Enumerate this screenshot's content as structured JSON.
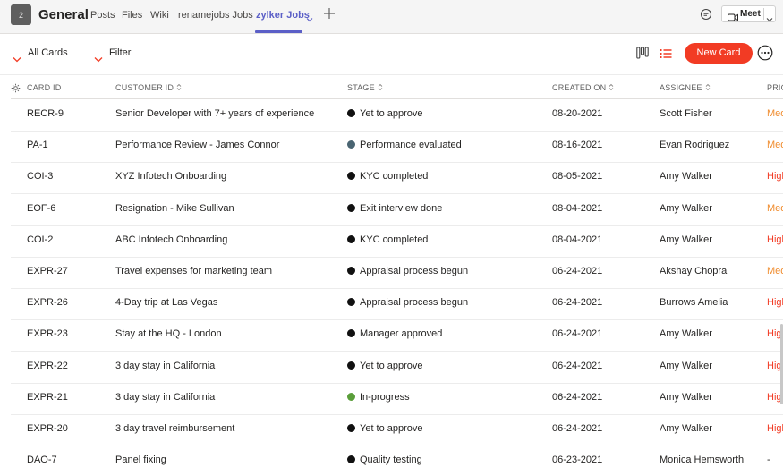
{
  "header": {
    "team_avatar": "2",
    "team_name": "General",
    "tabs": [
      {
        "label": "Posts"
      },
      {
        "label": "Files"
      },
      {
        "label": "Wiki"
      },
      {
        "label": "renamejobs Jobs"
      },
      {
        "label": "zylker Jobs"
      }
    ],
    "meet_label": "Meet"
  },
  "toolbar": {
    "view_label": "All Cards",
    "filter_label": "Filter",
    "new_card_label": "New Card"
  },
  "table": {
    "columns": {
      "card_id": "CARD ID",
      "customer_id": "CUSTOMER ID",
      "stage": "STAGE",
      "created_on": "CREATED ON",
      "assignee": "ASSIGNEE",
      "priority": "PRIO"
    },
    "rows": [
      {
        "card_id": "RECR-9",
        "customer": "Senior Developer with 7+ years of experience",
        "stage": "Yet to approve",
        "stage_color": "#111111",
        "created": "08-20-2021",
        "assignee": "Scott Fisher",
        "priority": "Med",
        "priority_level": "medium"
      },
      {
        "card_id": "PA-1",
        "customer": "Performance Review - James Connor",
        "stage": "Performance evaluated",
        "stage_color": "#4a6572",
        "created": "08-16-2021",
        "assignee": "Evan Rodriguez",
        "priority": "Med",
        "priority_level": "medium"
      },
      {
        "card_id": "COI-3",
        "customer": "XYZ Infotech Onboarding",
        "stage": "KYC completed",
        "stage_color": "#111111",
        "created": "08-05-2021",
        "assignee": "Amy Walker",
        "priority": "High",
        "priority_level": "high"
      },
      {
        "card_id": "EOF-6",
        "customer": "Resignation - Mike Sullivan",
        "stage": "Exit interview done",
        "stage_color": "#111111",
        "created": "08-04-2021",
        "assignee": "Amy Walker",
        "priority": "Med",
        "priority_level": "medium"
      },
      {
        "card_id": "COI-2",
        "customer": "ABC Infotech Onboarding",
        "stage": "KYC completed",
        "stage_color": "#111111",
        "created": "08-04-2021",
        "assignee": "Amy Walker",
        "priority": "High",
        "priority_level": "high"
      },
      {
        "card_id": "EXPR-27",
        "customer": "Travel expenses for marketing team",
        "stage": "Appraisal process begun",
        "stage_color": "#111111",
        "created": "06-24-2021",
        "assignee": "Akshay Chopra",
        "priority": "Med",
        "priority_level": "medium"
      },
      {
        "card_id": "EXPR-26",
        "customer": "4-Day trip at Las Vegas",
        "stage": "Appraisal process begun",
        "stage_color": "#111111",
        "created": "06-24-2021",
        "assignee": "Burrows Amelia",
        "priority": "High",
        "priority_level": "high"
      },
      {
        "card_id": "EXPR-23",
        "customer": "Stay at the HQ - London",
        "stage": "Manager approved",
        "stage_color": "#111111",
        "created": "06-24-2021",
        "assignee": "Amy Walker",
        "priority": "High",
        "priority_level": "high"
      },
      {
        "card_id": "EXPR-22",
        "customer": "3 day stay in California",
        "stage": "Yet to approve",
        "stage_color": "#111111",
        "created": "06-24-2021",
        "assignee": "Amy Walker",
        "priority": "High",
        "priority_level": "high"
      },
      {
        "card_id": "EXPR-21",
        "customer": "3 day stay in California",
        "stage": "In-progress",
        "stage_color": "#5a9e3a",
        "created": "06-24-2021",
        "assignee": "Amy Walker",
        "priority": "High",
        "priority_level": "high"
      },
      {
        "card_id": "EXPR-20",
        "customer": "3 day travel reimbursement",
        "stage": "Yet to approve",
        "stage_color": "#111111",
        "created": "06-24-2021",
        "assignee": "Amy Walker",
        "priority": "High",
        "priority_level": "high"
      },
      {
        "card_id": "DAO-7",
        "customer": "Panel fixing",
        "stage": "Quality testing",
        "stage_color": "#111111",
        "created": "06-23-2021",
        "assignee": "Monica Hemsworth",
        "priority": "-",
        "priority_level": "none"
      }
    ]
  },
  "colors": {
    "accent": "#5b5fc7",
    "new_card": "#f23b24",
    "priority_medium": "#f08c2e",
    "priority_high": "#f23b24"
  }
}
